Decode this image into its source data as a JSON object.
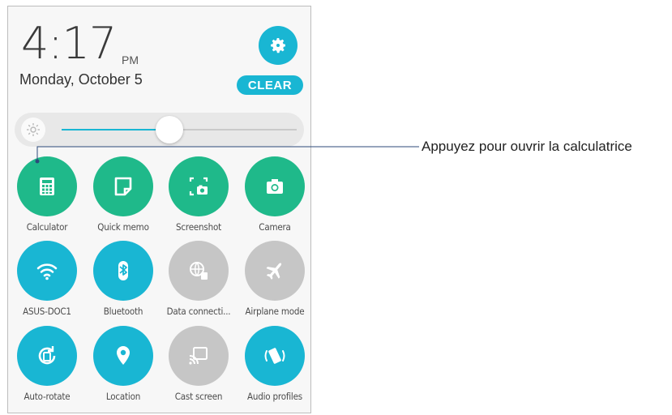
{
  "status": {
    "time": "4:17",
    "ampm": "PM",
    "date": "Monday, October 5"
  },
  "actions": {
    "clear_label": "CLEAR"
  },
  "brightness": {
    "level": 0.46
  },
  "colors": {
    "accent": "#19b6d3",
    "active_green": "#1fb98a",
    "inactive_gray": "#c6c6c6"
  },
  "tiles": [
    {
      "label": "Calculator",
      "icon": "calculator-icon",
      "state": "green"
    },
    {
      "label": "Quick memo",
      "icon": "memo-icon",
      "state": "green"
    },
    {
      "label": "Screenshot",
      "icon": "screenshot-icon",
      "state": "green"
    },
    {
      "label": "Camera",
      "icon": "camera-icon",
      "state": "green"
    },
    {
      "label": "ASUS-DOC1",
      "icon": "wifi-icon",
      "state": "blue"
    },
    {
      "label": "Bluetooth",
      "icon": "bluetooth-icon",
      "state": "blue"
    },
    {
      "label": "Data connecti...",
      "icon": "data-connection-icon",
      "state": "gray"
    },
    {
      "label": "Airplane mode",
      "icon": "airplane-icon",
      "state": "gray"
    },
    {
      "label": "Auto-rotate",
      "icon": "auto-rotate-icon",
      "state": "blue"
    },
    {
      "label": "Location",
      "icon": "location-icon",
      "state": "blue"
    },
    {
      "label": "Cast screen",
      "icon": "cast-screen-icon",
      "state": "gray"
    },
    {
      "label": "Audio profiles",
      "icon": "audio-profiles-icon",
      "state": "blue"
    }
  ],
  "callout": {
    "text": "Appuyez pour ouvrir la calculatrice"
  }
}
